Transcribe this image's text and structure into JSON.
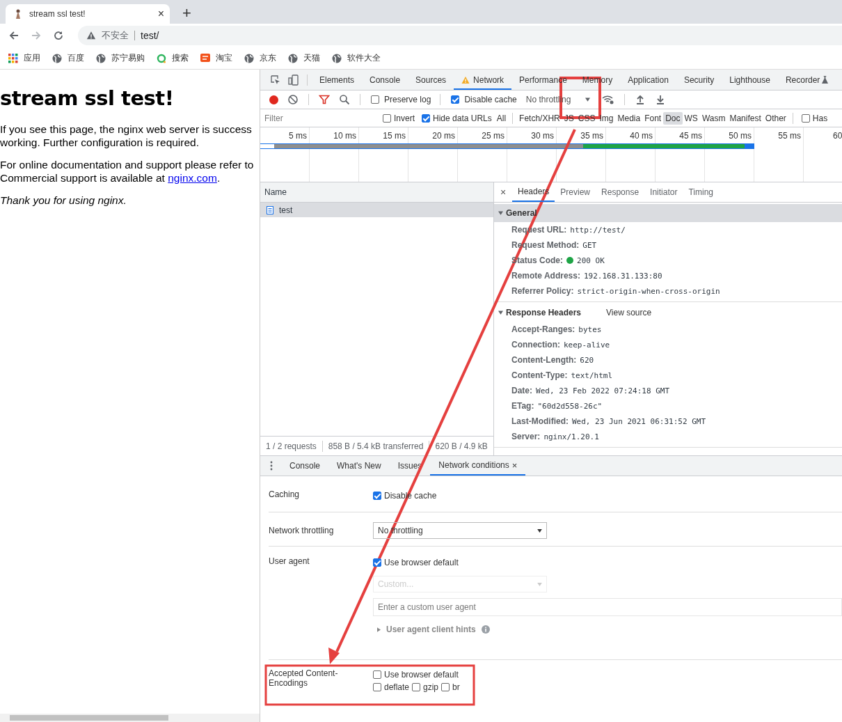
{
  "browser": {
    "tab": {
      "title": "stream ssl test!",
      "close": "×"
    },
    "new_tab": "+",
    "address": {
      "security": "不安全",
      "url": "test/"
    },
    "bookmarks": [
      {
        "label": "应用",
        "kind": "apps"
      },
      {
        "label": "百度",
        "kind": "globe"
      },
      {
        "label": "苏宁易购",
        "kind": "globe"
      },
      {
        "label": "搜索",
        "kind": "ring"
      },
      {
        "label": "淘宝",
        "kind": "shop"
      },
      {
        "label": "京东",
        "kind": "globe"
      },
      {
        "label": "天猫",
        "kind": "globe"
      },
      {
        "label": "软件大全",
        "kind": "globe"
      }
    ]
  },
  "page": {
    "heading": "stream ssl test!",
    "paragraph_1": [
      "If you see this page, the nginx web server is success",
      "working. Further configuration is required."
    ],
    "paragraph_2": [
      "For online documentation and support please refer to",
      "Commercial support is available at "
    ],
    "link": "nginx.com",
    "link_after": ".",
    "closing": "Thank you for using nginx."
  },
  "devtools": {
    "panel_tabs": [
      {
        "label": "Elements",
        "selected": false,
        "warning": false
      },
      {
        "label": "Console",
        "selected": false,
        "warning": false
      },
      {
        "label": "Sources",
        "selected": false,
        "warning": false
      },
      {
        "label": "Network",
        "selected": true,
        "warning": true
      },
      {
        "label": "Performance",
        "selected": false,
        "warning": false
      },
      {
        "label": "Memory",
        "selected": false,
        "warning": false
      },
      {
        "label": "Application",
        "selected": false,
        "warning": false
      },
      {
        "label": "Security",
        "selected": false,
        "warning": false
      },
      {
        "label": "Lighthouse",
        "selected": false,
        "warning": false
      },
      {
        "label": "Recorder",
        "selected": false,
        "warning": false
      }
    ],
    "toolbar": {
      "preserve_log": {
        "label": "Preserve log",
        "checked": false
      },
      "disable_cache": {
        "label": "Disable cache",
        "checked": true
      },
      "throttling": "No throttling"
    },
    "filter": {
      "placeholder": "Filter",
      "invert": {
        "label": "Invert",
        "checked": false
      },
      "hide_data_urls": {
        "label": "Hide data URLs",
        "checked": true
      },
      "types": [
        {
          "label": "All",
          "selected": false
        },
        {
          "label": "Fetch/XHR",
          "selected": false
        },
        {
          "label": "JS",
          "selected": false
        },
        {
          "label": "CSS",
          "selected": false
        },
        {
          "label": "Img",
          "selected": false
        },
        {
          "label": "Media",
          "selected": false
        },
        {
          "label": "Font",
          "selected": false
        },
        {
          "label": "Doc",
          "selected": true
        },
        {
          "label": "WS",
          "selected": false
        },
        {
          "label": "Wasm",
          "selected": false
        },
        {
          "label": "Manifest",
          "selected": false
        },
        {
          "label": "Other",
          "selected": false
        }
      ],
      "blocked": {
        "label": "Has",
        "checked": false
      }
    },
    "timeline": {
      "ticks": [
        "5 ms",
        "10 ms",
        "15 ms",
        "20 ms",
        "25 ms",
        "30 ms",
        "35 ms",
        "40 ms",
        "45 ms",
        "50 ms",
        "55 ms",
        "60"
      ]
    },
    "requests": {
      "column": "Name",
      "rows": [
        {
          "name": "test",
          "selected": true
        }
      ],
      "footer": [
        "1 / 2 requests",
        "858 B / 5.4 kB transferred",
        "620 B / 4.9 kB"
      ]
    },
    "details": {
      "close": "×",
      "tabs": [
        {
          "label": "Headers",
          "selected": true
        },
        {
          "label": "Preview",
          "selected": false
        },
        {
          "label": "Response",
          "selected": false
        },
        {
          "label": "Initiator",
          "selected": false
        },
        {
          "label": "Timing",
          "selected": false
        }
      ],
      "sections": [
        {
          "title": "General",
          "expanded": true,
          "rows": [
            {
              "name": "Request URL:",
              "value": "http://test/",
              "kind": "text"
            },
            {
              "name": "Request Method:",
              "value": "GET",
              "kind": "text"
            },
            {
              "name": "Status Code:",
              "value": "200 OK",
              "kind": "status"
            },
            {
              "name": "Remote Address:",
              "value": "192.168.31.133:80",
              "kind": "text"
            },
            {
              "name": "Referrer Policy:",
              "value": "strict-origin-when-cross-origin",
              "kind": "text"
            }
          ]
        },
        {
          "title": "Response Headers",
          "expanded": true,
          "view_source": "View source",
          "rows": [
            {
              "name": "Accept-Ranges:",
              "value": "bytes",
              "kind": "text"
            },
            {
              "name": "Connection:",
              "value": "keep-alive",
              "kind": "text"
            },
            {
              "name": "Content-Length:",
              "value": "620",
              "kind": "text"
            },
            {
              "name": "Content-Type:",
              "value": "text/html",
              "kind": "text"
            },
            {
              "name": "Date:",
              "value": "Wed, 23 Feb 2022 07:24:18 GMT",
              "kind": "text"
            },
            {
              "name": "ETag:",
              "value": "\"60d2d558-26c\"",
              "kind": "text"
            },
            {
              "name": "Last-Modified:",
              "value": "Wed, 23 Jun 2021 06:31:52 GMT",
              "kind": "text"
            },
            {
              "name": "Server:",
              "value": "nginx/1.20.1",
              "kind": "text"
            }
          ]
        }
      ]
    },
    "drawer": {
      "tabs": [
        {
          "label": "Console",
          "selected": false,
          "closable": false
        },
        {
          "label": "What's New",
          "selected": false,
          "closable": false
        },
        {
          "label": "Issues",
          "selected": false,
          "closable": false
        },
        {
          "label": "Network conditions",
          "selected": true,
          "closable": true
        }
      ],
      "close": "×",
      "caching": {
        "label": "Caching",
        "option": "Disable cache",
        "checked": true
      },
      "throttling": {
        "label": "Network throttling",
        "value": "No throttling"
      },
      "user_agent": {
        "label": "User agent",
        "option": "Use browser default",
        "checked": true,
        "custom": "Custom...",
        "placeholder": "Enter a custom user agent",
        "hints": "User agent client hints",
        "hints_expanded": false
      },
      "encodings": {
        "label": "Accepted Content-Encodings",
        "use_default": {
          "label": "Use browser default",
          "checked": false
        },
        "options": [
          {
            "label": "deflate",
            "checked": false
          },
          {
            "label": "gzip",
            "checked": false
          },
          {
            "label": "br",
            "checked": false
          }
        ]
      }
    }
  }
}
